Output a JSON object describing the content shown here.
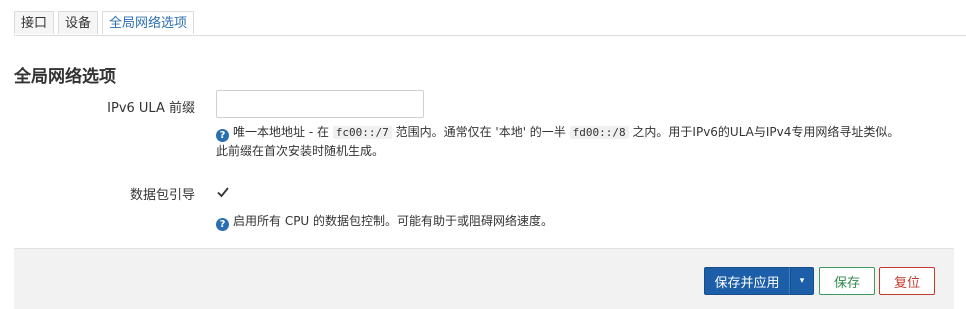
{
  "tabs": [
    {
      "label": "接口",
      "active": false
    },
    {
      "label": "设备",
      "active": false
    },
    {
      "label": "全局网络选项",
      "active": true
    }
  ],
  "section": {
    "title": "全局网络选项"
  },
  "ipv6_ula": {
    "label": "IPv6 ULA 前缀",
    "value": "",
    "help_parts": {
      "p1": "唯一本地地址 - 在 ",
      "code1": "fc00::/7",
      "p2": " 范围内。通常仅在 '本地' 的一半 ",
      "code2": "fd00::/8",
      "p3": " 之内。用于IPv6的ULA与IPv4专用网络寻址类似。",
      "line2": "此前缀在首次安装时随机生成。"
    }
  },
  "packet_steering": {
    "label": "数据包引导",
    "checked": true,
    "help": "启用所有 CPU 的数据包控制。可能有助于或阻碍网络速度。"
  },
  "actions": {
    "apply_label": "保存并应用",
    "dropdown_glyph": "▾",
    "save_label": "保存",
    "reset_label": "复位"
  },
  "icons": {
    "help": "?",
    "check": "✓"
  },
  "colors": {
    "accent": "#2b6fb3",
    "primary_button": "#1c5fa8",
    "save": "#2e8a4a",
    "reset": "#c0392b"
  }
}
